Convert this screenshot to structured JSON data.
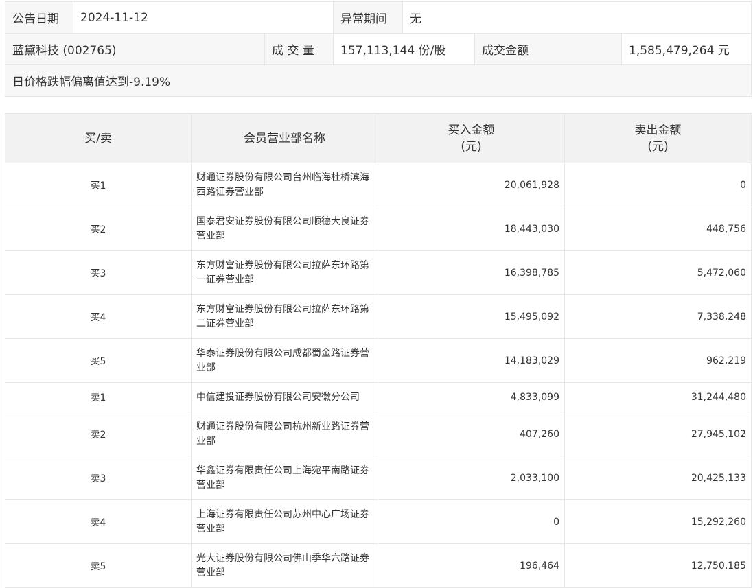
{
  "info": {
    "date_label": "公告日期",
    "date_value": "2024-11-12",
    "period_label": "异常期间",
    "period_value": "无",
    "stock": "蓝黛科技 (002765)",
    "volume_label": "成 交 量",
    "volume_value": "157,113,144 份/股",
    "amount_label": "成交金额",
    "amount_value": "1,585,479,264 元",
    "reason": "日价格跌幅偏离值达到-9.19%"
  },
  "table": {
    "headers": {
      "side": "买/卖",
      "name": "会员营业部名称",
      "buy_line1": "买入金额",
      "buy_line2": "(元)",
      "sell_line1": "卖出金额",
      "sell_line2": "(元)"
    },
    "rows": [
      {
        "side": "买1",
        "name": "财通证券股份有限公司台州临海杜桥滨海西路证券营业部",
        "buy": "20,061,928",
        "sell": "0"
      },
      {
        "side": "买2",
        "name": "国泰君安证券股份有限公司顺德大良证券营业部",
        "buy": "18,443,030",
        "sell": "448,756"
      },
      {
        "side": "买3",
        "name": "东方财富证券股份有限公司拉萨东环路第一证券营业部",
        "buy": "16,398,785",
        "sell": "5,472,060"
      },
      {
        "side": "买4",
        "name": "东方财富证券股份有限公司拉萨东环路第二证券营业部",
        "buy": "15,495,092",
        "sell": "7,338,248"
      },
      {
        "side": "买5",
        "name": "华泰证券股份有限公司成都蜀金路证券营业部",
        "buy": "14,183,029",
        "sell": "962,219"
      },
      {
        "side": "卖1",
        "name": "中信建投证券股份有限公司安徽分公司",
        "buy": "4,833,099",
        "sell": "31,244,480"
      },
      {
        "side": "卖2",
        "name": "财通证券股份有限公司杭州新业路证券营业部",
        "buy": "407,260",
        "sell": "27,945,102"
      },
      {
        "side": "卖3",
        "name": "华鑫证券有限责任公司上海宛平南路证券营业部",
        "buy": "2,033,100",
        "sell": "20,425,133"
      },
      {
        "side": "卖4",
        "name": "上海证券有限责任公司苏州中心广场证券营业部",
        "buy": "0",
        "sell": "15,292,260"
      },
      {
        "side": "卖5",
        "name": "光大证券股份有限公司佛山季华六路证券营业部",
        "buy": "196,464",
        "sell": "12,750,185"
      }
    ]
  }
}
